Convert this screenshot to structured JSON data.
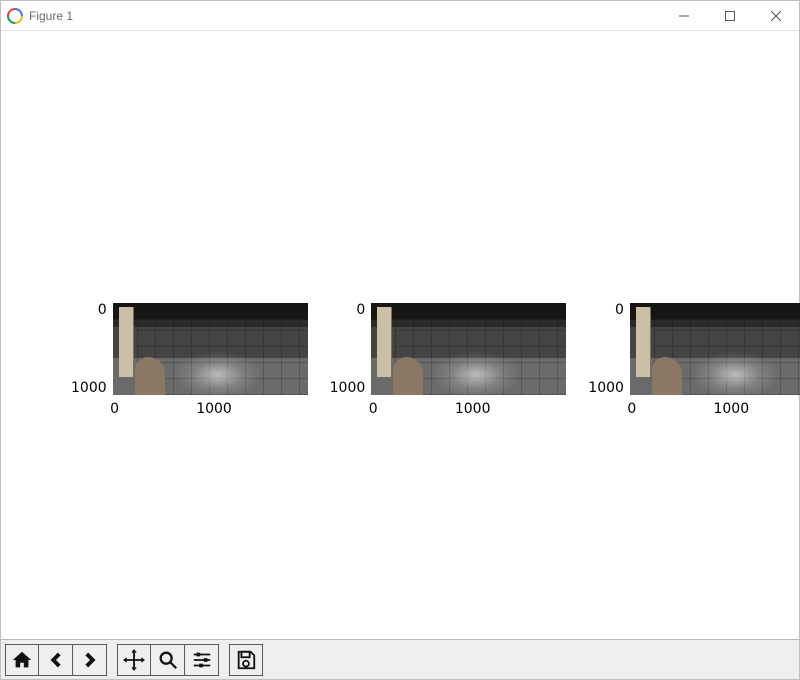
{
  "window": {
    "title": "Figure 1"
  },
  "axes_common": {
    "y_ticks": [
      "0",
      "1000"
    ],
    "x_ticks": [
      {
        "label": "0",
        "pos_pct": 1
      },
      {
        "label": "1000",
        "pos_pct": 52
      }
    ]
  },
  "subplots": [
    {
      "kind": "image-gray",
      "x_range": [
        0,
        1750
      ],
      "y_range": [
        0,
        1000
      ]
    },
    {
      "kind": "image-gray",
      "x_range": [
        0,
        1750
      ],
      "y_range": [
        0,
        1000
      ]
    },
    {
      "kind": "image-gray",
      "x_range": [
        0,
        1750
      ],
      "y_range": [
        0,
        1000
      ]
    }
  ],
  "toolbar": {
    "home": "Home",
    "back": "Back",
    "forward": "Forward",
    "pan": "Pan",
    "zoom": "Zoom",
    "subplots": "Configure subplots",
    "save": "Save"
  }
}
